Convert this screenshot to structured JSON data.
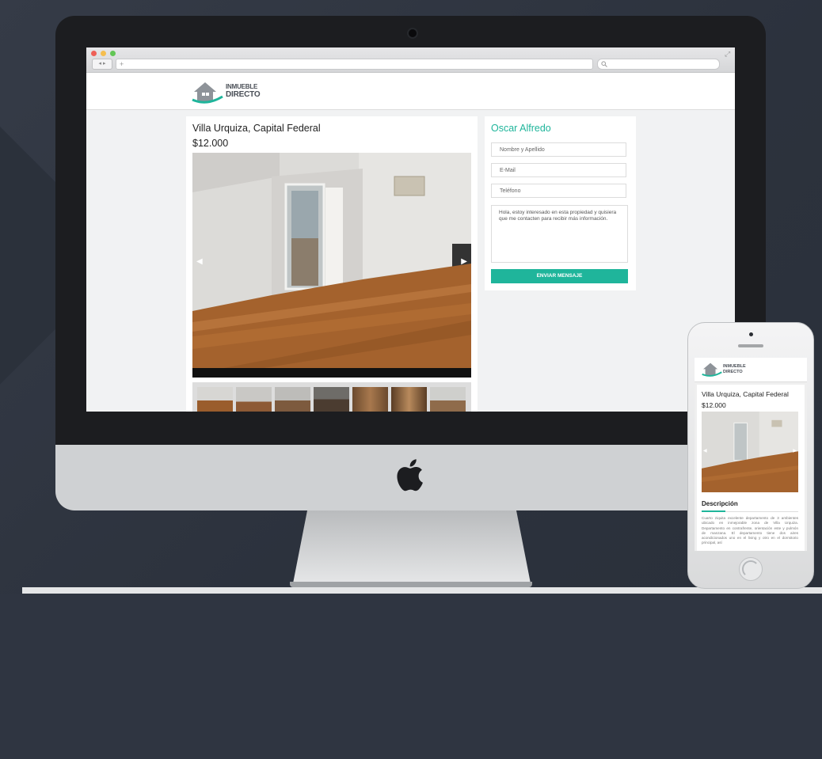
{
  "browser": {
    "url_placeholder": "+",
    "nav_label": "◂ ▸"
  },
  "site": {
    "logo_line1": "INMUEBLE",
    "logo_line2": "DIRECTO"
  },
  "listing": {
    "title": "Villa Urquiza, Capital Federal",
    "price": "$12.000",
    "thumbnail_count": 7
  },
  "contact": {
    "agent_name": "Oscar Alfredo",
    "name_placeholder": "Nombre y Apellido",
    "email_placeholder": "E-Mail",
    "phone_placeholder": "Teléfono",
    "message": "Hola, estoy interesado en esta propiedad y quisiera que me contacten para recibir más información.",
    "send_label": "ENVIAR MENSAJE"
  },
  "mobile": {
    "title": "Villa Urquiza, Capital Federal",
    "price": "$12.000",
    "description_heading": "Descripción",
    "description_text": "Cuarto ziquita excelente departamento de 3 ambientes ubicado en inmejorable zona de Villa Urquiza. Departamento en contrafrente, orientación este y pulmón de manzana. El departamento tiene dos aires acondicionados uno en el living y otro en el dormitorio principal, así"
  },
  "colors": {
    "accent": "#1fb59b",
    "background": "#2f3541"
  }
}
